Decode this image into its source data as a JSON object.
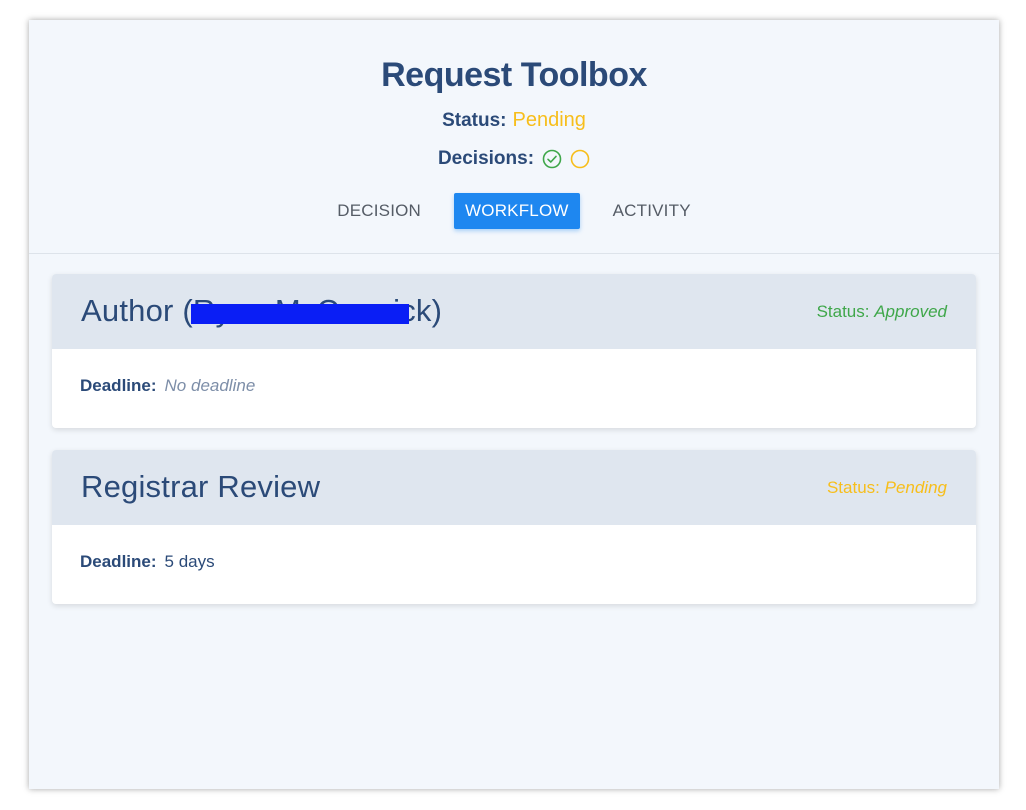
{
  "header": {
    "title": "Request Toolbox",
    "status_label": "Status:",
    "status_value": "Pending",
    "decisions_label": "Decisions:",
    "decision_icons": [
      "check-circle-icon",
      "empty-circle-icon"
    ]
  },
  "tabs": [
    {
      "label": "DECISION",
      "active": false
    },
    {
      "label": "WORKFLOW",
      "active": true
    },
    {
      "label": "ACTIVITY",
      "active": false
    }
  ],
  "workflow": [
    {
      "title": "Author (Ryan McCormick)",
      "title_redacted": true,
      "status_label": "Status:",
      "status_value": "Approved",
      "deadline_label": "Deadline:",
      "deadline_value": "No deadline"
    },
    {
      "title": "Registrar Review",
      "status_label": "Status:",
      "status_value": "Pending",
      "deadline_label": "Deadline:",
      "deadline_value": "5 days"
    }
  ],
  "colors": {
    "primary_text": "#2b4a78",
    "pending": "#f7be1b",
    "approved": "#3fa74a",
    "active_tab": "#1e87f0",
    "redaction": "#0a1ef5"
  }
}
